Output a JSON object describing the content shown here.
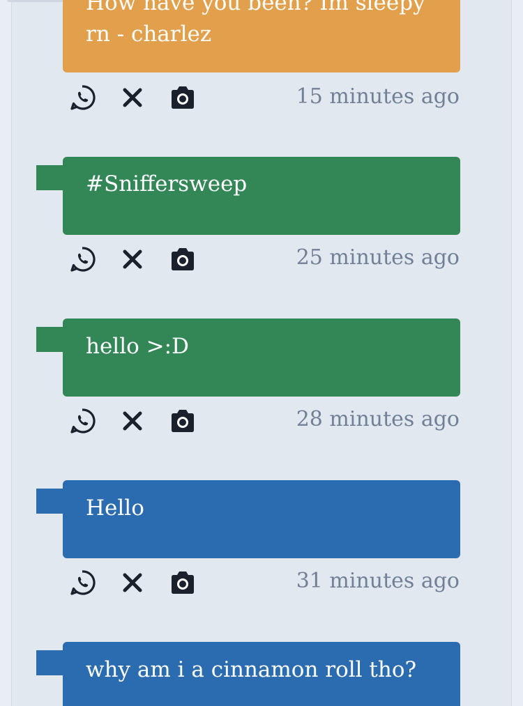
{
  "messages": [
    {
      "text": "How have you been? Im sleepy rn - charlez",
      "time": "15 minutes ago",
      "color": "#e2a04c"
    },
    {
      "text": "#Sniffersweep",
      "time": "25 minutes ago",
      "color": "#338757"
    },
    {
      "text": "hello >:D",
      "time": "28 minutes ago",
      "color": "#338757"
    },
    {
      "text": "Hello",
      "time": "31 minutes ago",
      "color": "#2b6cb0"
    },
    {
      "text": "why am i a cinnamon roll tho?",
      "time": "",
      "color": "#2b6cb0"
    }
  ],
  "icons": [
    "whatsapp-icon",
    "close-icon",
    "camera-icon"
  ]
}
